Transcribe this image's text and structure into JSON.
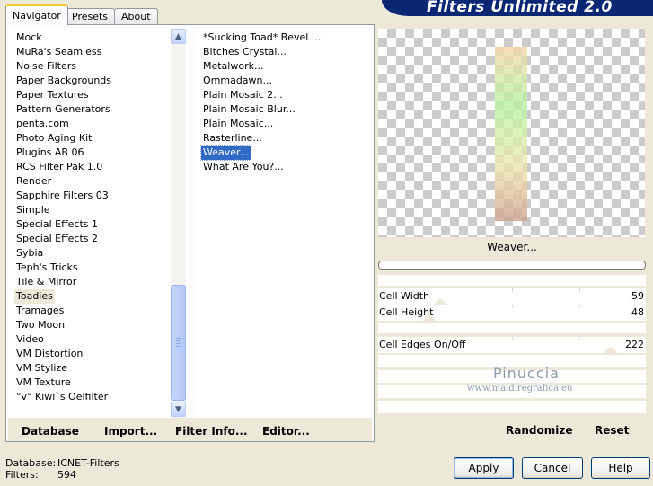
{
  "tabs": [
    "Navigator",
    "Presets",
    "About"
  ],
  "banner_title": "Filters Unlimited 2.0",
  "categories": [
    "Mock",
    "MuRa's Seamless",
    "Noise Filters",
    "Paper Backgrounds",
    "Paper Textures",
    "Pattern Generators",
    "penta.com",
    "Photo Aging Kit",
    "Plugins AB 06",
    "RCS Filter Pak 1.0",
    "Render",
    "Sapphire Filters 03",
    "Simple",
    "Special Effects 1",
    "Special Effects 2",
    "Sybia",
    "Teph's Tricks",
    "Tile & Mirror",
    "Toadies",
    "Tramages",
    "Two Moon",
    "Video",
    "VM Distortion",
    "VM Stylize",
    "VM Texture",
    "°v° Kiwi`s Oelfilter"
  ],
  "selected_category": "Toadies",
  "filters": [
    "*Sucking Toad*  Bevel I...",
    "Bitches Crystal...",
    "Metalwork...",
    "Ommadawn...",
    "Plain Mosaic 2...",
    "Plain Mosaic Blur...",
    "Plain Mosaic...",
    "Rasterline...",
    "Weaver...",
    "What Are You?..."
  ],
  "selected_filter": "Weaver...",
  "list_buttons": {
    "database": "Database",
    "import": "Import...",
    "filter_info": "Filter Info...",
    "editor": "Editor..."
  },
  "preview": {
    "filter_name": "Weaver...",
    "strip_colors": [
      "#f2d6a8",
      "#d8e9a8",
      "#b6f0a0",
      "#d2f0a8",
      "#ece8b0",
      "#e6c8a0",
      "#c9a090"
    ]
  },
  "params": [
    {
      "label": "Cell Width",
      "value": "59",
      "level": 0.23
    },
    {
      "label": "Cell Height",
      "value": "48",
      "level": 0.19
    },
    {
      "label": "Cell Edges On/Off",
      "value": "222",
      "level": 0.87
    }
  ],
  "param_buttons": {
    "randomize": "Randomize",
    "reset": "Reset"
  },
  "watermark": {
    "name": "Pinuccia",
    "site": "www.maidiregrafica.eu"
  },
  "status": {
    "database_label": "Database:",
    "database_value": "ICNET-Filters",
    "filters_label": "Filters:",
    "filters_value": "594"
  },
  "dialog_buttons": {
    "apply": "Apply",
    "cancel": "Cancel",
    "help": "Help"
  }
}
